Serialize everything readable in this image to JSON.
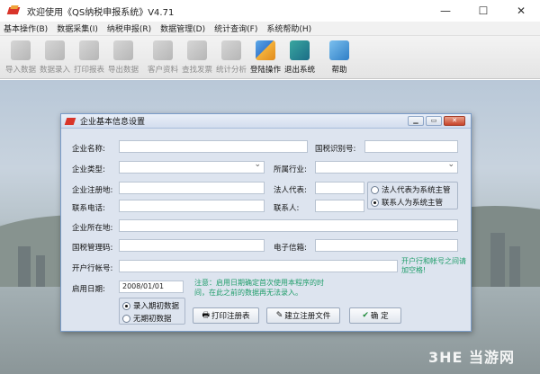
{
  "app": {
    "title": "欢迎使用《QS纳税申报系统》V4.71",
    "window_buttons": [
      "—",
      "☐",
      "✕"
    ]
  },
  "menu": [
    "基本操作(B)",
    "数据采集(I)",
    "纳税申报(R)",
    "数据管理(D)",
    "统计查询(F)",
    "系统帮助(H)"
  ],
  "toolbar": {
    "buttons": [
      {
        "label": "导入数据",
        "icon": "import-icon",
        "enabled": false
      },
      {
        "label": "数据录入",
        "icon": "data-entry-icon",
        "enabled": false
      },
      {
        "label": "打印报表",
        "icon": "print-report-icon",
        "enabled": false
      },
      {
        "label": "导出数据",
        "icon": "export-icon",
        "enabled": false
      },
      {
        "label": "客户资料",
        "icon": "customer-icon",
        "enabled": false
      },
      {
        "label": "查找发票",
        "icon": "find-invoice-icon",
        "enabled": false
      },
      {
        "label": "统计分析",
        "icon": "statistics-icon",
        "enabled": false
      },
      {
        "label": "登陆操作",
        "icon": "login-icon",
        "enabled": true
      },
      {
        "label": "退出系统",
        "icon": "exit-icon",
        "enabled": true
      },
      {
        "label": "帮助",
        "icon": "help-icon",
        "enabled": true
      }
    ]
  },
  "dialog": {
    "title": "企业基本信息设置",
    "labels": {
      "company_name": "企业名称:",
      "tax_id": "国税识别号:",
      "company_type": "企业类型:",
      "industry": "所属行业:",
      "reg_address": "企业注册地:",
      "legal_rep": "法人代表:",
      "phone": "联系电话:",
      "contact": "联系人:",
      "location": "企业所在地:",
      "tax_code": "国税管理码:",
      "email": "电子信箱:",
      "bank_account": "开户行帐号:",
      "start_date": "启用日期:"
    },
    "values": {
      "company_name": "",
      "tax_id": "",
      "company_type": "",
      "industry": "",
      "reg_address": "",
      "legal_rep": "",
      "phone": "",
      "contact": "",
      "location": "",
      "tax_code": "",
      "email": "",
      "bank_account": "",
      "start_date": "2008/01/01"
    },
    "contact_radio": [
      {
        "label": "法人代表为系统主管",
        "checked": false
      },
      {
        "label": "联系人为系统主管",
        "checked": true
      }
    ],
    "bank_note": "开户行和帐号之间请加空格!",
    "date_note_line1": "注意：启用日期确定首次使用本程序的时",
    "date_note_line2": "间，在此之前的数据再无法录入。",
    "data_radio": [
      {
        "label": "录入期初数据",
        "checked": true
      },
      {
        "label": "无期初数据",
        "checked": false
      }
    ],
    "buttons": {
      "print": "打印注册表",
      "create_file": "建立注册文件",
      "ok": "确  定"
    }
  },
  "watermark": "3HE 当游网",
  "colors": {
    "dialog_bg": "#dde4ef",
    "note_green": "#1f9d6a",
    "brand_red": "#d9352a"
  }
}
